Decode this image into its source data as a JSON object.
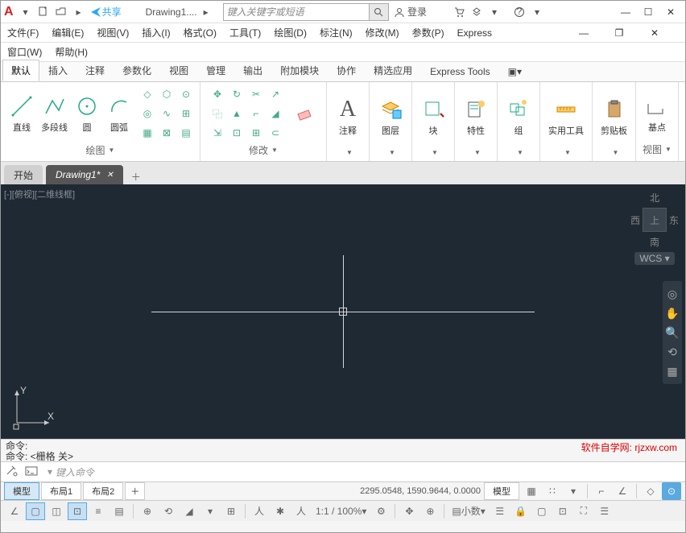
{
  "title": {
    "doc": "Drawing1....",
    "share": "共享",
    "login": "登录"
  },
  "search": {
    "placeholder": "键入关键字或短语"
  },
  "menu": [
    "文件(F)",
    "编辑(E)",
    "视图(V)",
    "插入(I)",
    "格式(O)",
    "工具(T)",
    "绘图(D)",
    "标注(N)",
    "修改(M)",
    "参数(P)",
    "Express"
  ],
  "menu2": [
    "窗口(W)",
    "帮助(H)"
  ],
  "ribbontabs": [
    "默认",
    "插入",
    "注释",
    "参数化",
    "视图",
    "管理",
    "输出",
    "附加模块",
    "协作",
    "精选应用",
    "Express Tools"
  ],
  "ribbon": {
    "draw": {
      "items": [
        "直线",
        "多段线",
        "圆",
        "圆弧"
      ],
      "title": "绘图"
    },
    "modify": {
      "title": "修改"
    },
    "annot": {
      "title": "注释"
    },
    "layer": {
      "title": "图层"
    },
    "block": {
      "title": "块"
    },
    "prop": {
      "title": "特性"
    },
    "group": {
      "title": "组"
    },
    "util": {
      "title": "实用工具"
    },
    "clip": {
      "title": "剪贴板"
    },
    "view": {
      "title": "视图",
      "sub": "基点"
    }
  },
  "doctabs": {
    "start": "开始",
    "active": "Drawing1*"
  },
  "canvas": {
    "viewport": "[-][俯视][二维线框]",
    "wcs": "WCS",
    "compass": {
      "n": "北",
      "s": "南",
      "e": "东",
      "w": "西",
      "t": "上"
    }
  },
  "cmd": {
    "hist1": "命令:",
    "hist2": "命令:  <栅格 关>",
    "placeholder": "键入命令",
    "watermark": "软件自学网: rjzxw.com"
  },
  "layout": {
    "tabs": [
      "模型",
      "布局1",
      "布局2"
    ]
  },
  "status": {
    "coords": "2295.0548, 1590.9644, 0.0000",
    "model": "模型",
    "scale": "1:1 / 100%",
    "decimal": "小数"
  }
}
